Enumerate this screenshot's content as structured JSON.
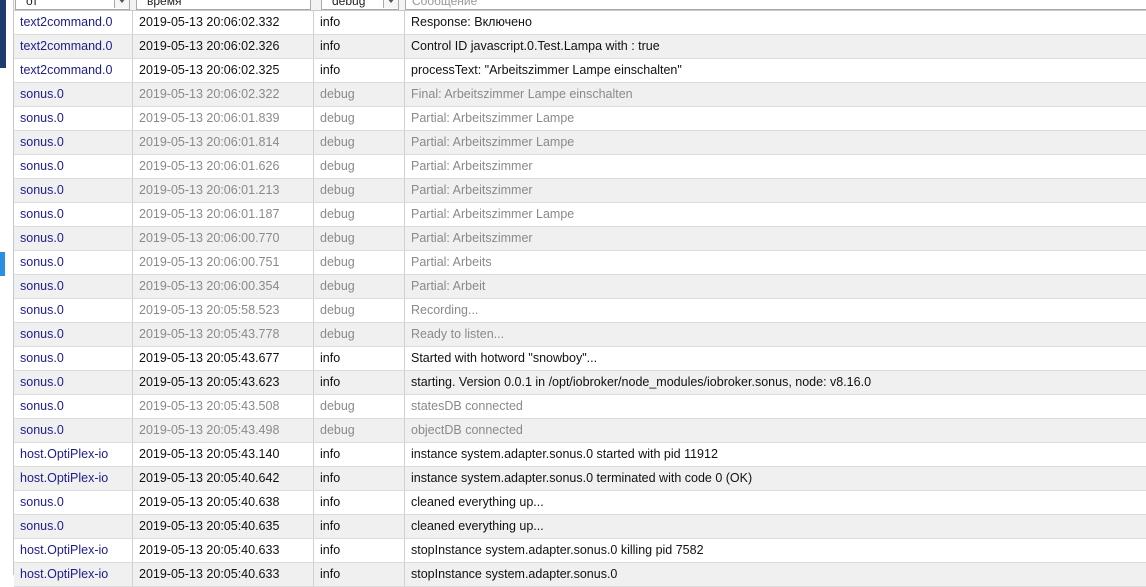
{
  "columns": {
    "from": "от",
    "time": "время",
    "severity": "debug",
    "message_placeholder": "Сообщение"
  },
  "rows": [
    {
      "from": "text2command.0",
      "time": "2019-05-13 20:06:02.332",
      "severity": "info",
      "message": "Response: Включено"
    },
    {
      "from": "text2command.0",
      "time": "2019-05-13 20:06:02.326",
      "severity": "info",
      "message": "Control ID javascript.0.Test.Lampa with : true"
    },
    {
      "from": "text2command.0",
      "time": "2019-05-13 20:06:02.325",
      "severity": "info",
      "message": "processText: \"Arbeitszimmer Lampe einschalten\""
    },
    {
      "from": "sonus.0",
      "time": "2019-05-13 20:06:02.322",
      "severity": "debug",
      "message": "Final: Arbeitszimmer Lampe einschalten"
    },
    {
      "from": "sonus.0",
      "time": "2019-05-13 20:06:01.839",
      "severity": "debug",
      "message": "Partial: Arbeitszimmer Lampe"
    },
    {
      "from": "sonus.0",
      "time": "2019-05-13 20:06:01.814",
      "severity": "debug",
      "message": "Partial: Arbeitszimmer Lampe"
    },
    {
      "from": "sonus.0",
      "time": "2019-05-13 20:06:01.626",
      "severity": "debug",
      "message": "Partial: Arbeitszimmer"
    },
    {
      "from": "sonus.0",
      "time": "2019-05-13 20:06:01.213",
      "severity": "debug",
      "message": "Partial: Arbeitszimmer"
    },
    {
      "from": "sonus.0",
      "time": "2019-05-13 20:06:01.187",
      "severity": "debug",
      "message": "Partial: Arbeitszimmer Lampe"
    },
    {
      "from": "sonus.0",
      "time": "2019-05-13 20:06:00.770",
      "severity": "debug",
      "message": "Partial: Arbeitszimmer"
    },
    {
      "from": "sonus.0",
      "time": "2019-05-13 20:06:00.751",
      "severity": "debug",
      "message": "Partial: Arbeits"
    },
    {
      "from": "sonus.0",
      "time": "2019-05-13 20:06:00.354",
      "severity": "debug",
      "message": "Partial: Arbeit"
    },
    {
      "from": "sonus.0",
      "time": "2019-05-13 20:05:58.523",
      "severity": "debug",
      "message": "Recording..."
    },
    {
      "from": "sonus.0",
      "time": "2019-05-13 20:05:43.778",
      "severity": "debug",
      "message": "Ready to listen..."
    },
    {
      "from": "sonus.0",
      "time": "2019-05-13 20:05:43.677",
      "severity": "info",
      "message": "Started with hotword \"snowboy\"..."
    },
    {
      "from": "sonus.0",
      "time": "2019-05-13 20:05:43.623",
      "severity": "info",
      "message": "starting. Version 0.0.1 in /opt/iobroker/node_modules/iobroker.sonus, node: v8.16.0"
    },
    {
      "from": "sonus.0",
      "time": "2019-05-13 20:05:43.508",
      "severity": "debug",
      "message": "statesDB connected"
    },
    {
      "from": "sonus.0",
      "time": "2019-05-13 20:05:43.498",
      "severity": "debug",
      "message": "objectDB connected"
    },
    {
      "from": "host.OptiPlex-io",
      "time": "2019-05-13 20:05:43.140",
      "severity": "info",
      "message": "instance system.adapter.sonus.0 started with pid 11912"
    },
    {
      "from": "host.OptiPlex-io",
      "time": "2019-05-13 20:05:40.642",
      "severity": "info",
      "message": "instance system.adapter.sonus.0 terminated with code 0 (OK)"
    },
    {
      "from": "sonus.0",
      "time": "2019-05-13 20:05:40.638",
      "severity": "info",
      "message": "cleaned everything up..."
    },
    {
      "from": "sonus.0",
      "time": "2019-05-13 20:05:40.635",
      "severity": "info",
      "message": "cleaned everything up..."
    },
    {
      "from": "host.OptiPlex-io",
      "time": "2019-05-13 20:05:40.633",
      "severity": "info",
      "message": "stopInstance system.adapter.sonus.0 killing pid 7582"
    },
    {
      "from": "host.OptiPlex-io",
      "time": "2019-05-13 20:05:40.633",
      "severity": "info",
      "message": "stopInstance system.adapter.sonus.0"
    }
  ]
}
